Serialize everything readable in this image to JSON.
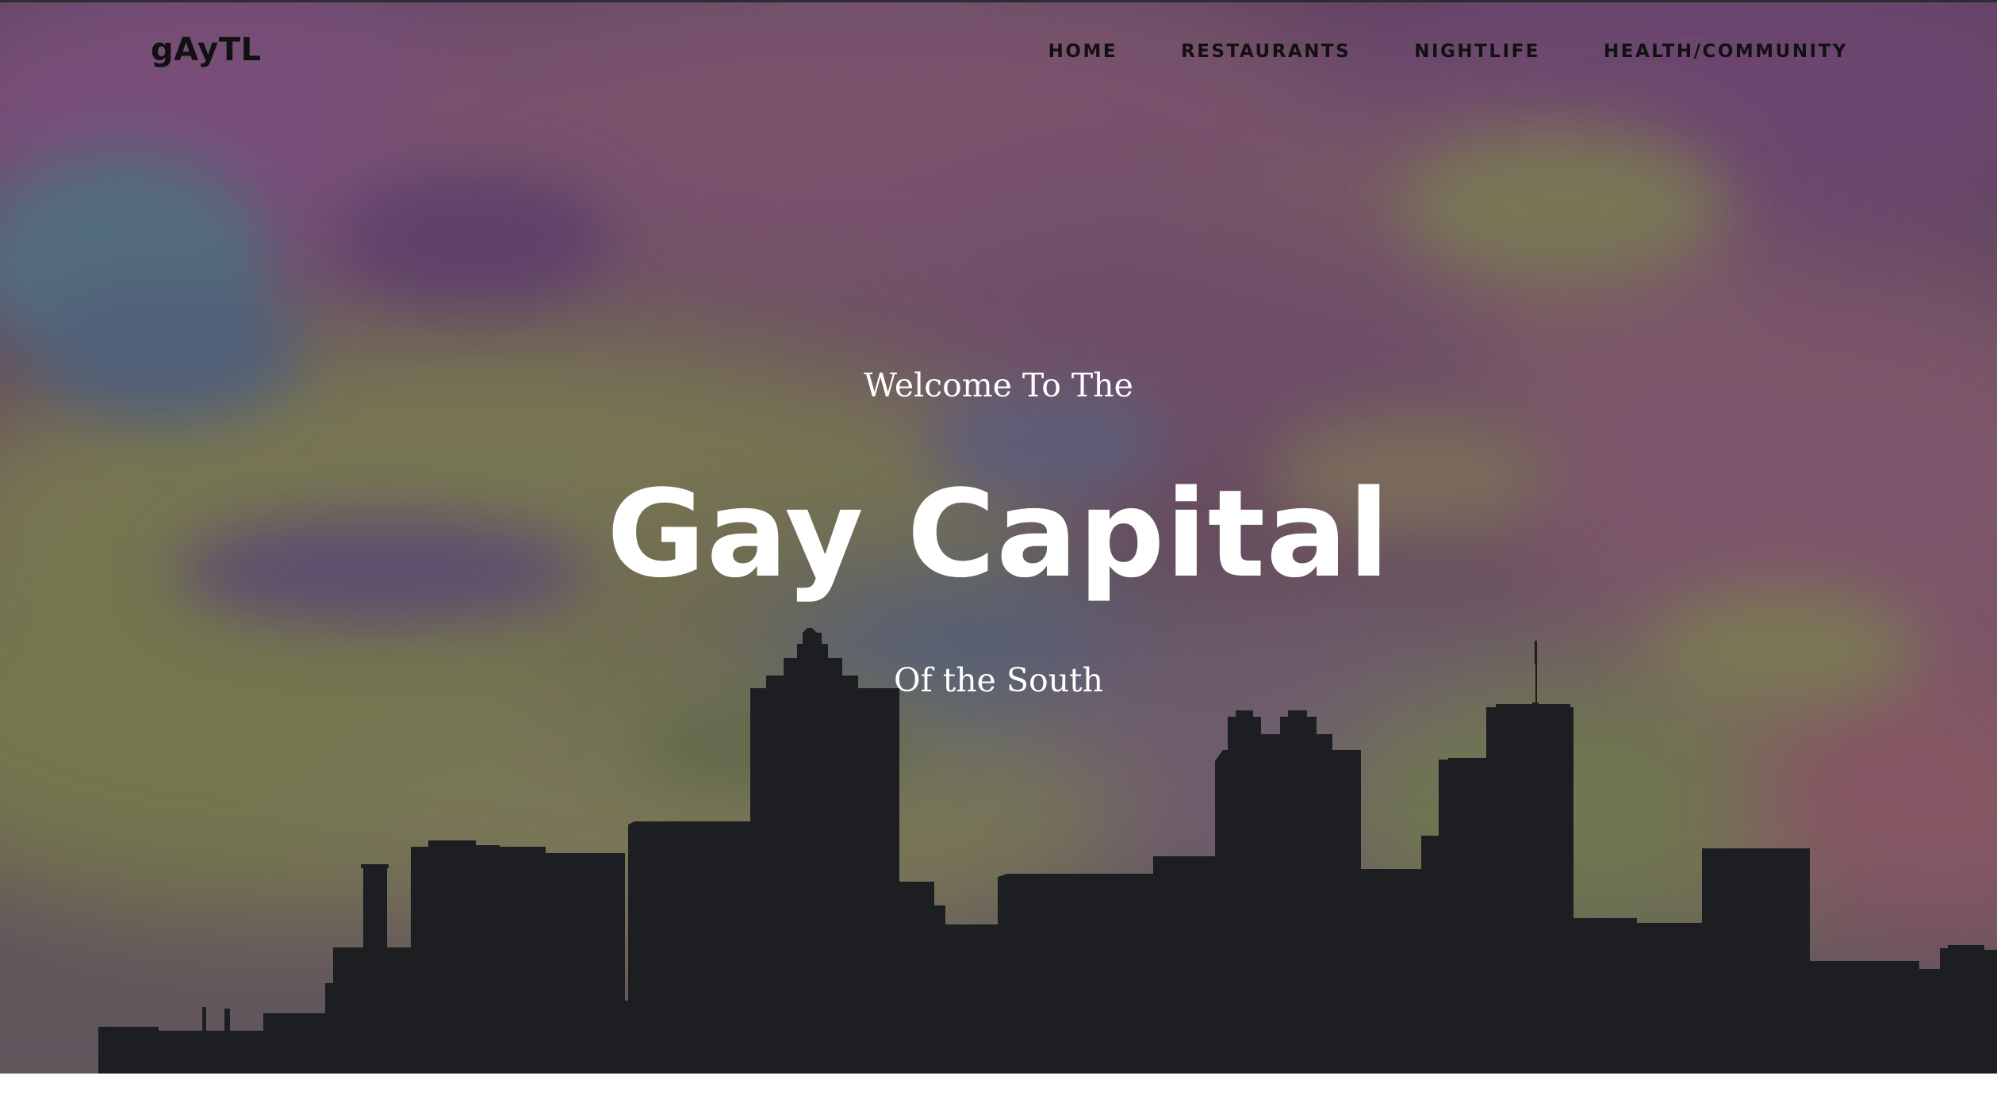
{
  "brand": {
    "name": "gAyTL"
  },
  "nav": {
    "items": [
      {
        "label": "HOME"
      },
      {
        "label": "RESTAURANTS"
      },
      {
        "label": "NIGHTLIFE"
      },
      {
        "label": "HEALTH/COMMUNITY"
      }
    ]
  },
  "hero": {
    "kicker": "Welcome To The",
    "title": "Gay Capital",
    "subtitle": "Of the South"
  },
  "colors": {
    "nav_text": "#111111",
    "hero_text": "#ffffff",
    "skyline": "#1b1f20",
    "page_background": "#ffffff"
  }
}
